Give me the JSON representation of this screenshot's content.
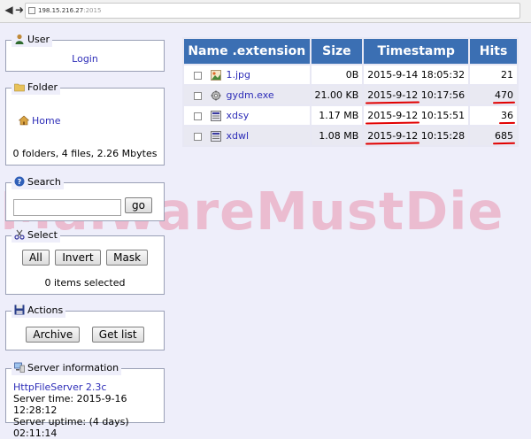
{
  "browser": {
    "url_host": "198.15.216.27",
    "url_port": ":2015"
  },
  "panels": {
    "user": {
      "title": "User",
      "login_label": "Login"
    },
    "folder": {
      "title": "Folder",
      "home_label": "Home",
      "summary": "0 folders, 4 files, 2.26 Mbytes"
    },
    "search": {
      "title": "Search",
      "input_value": "",
      "go_label": "go"
    },
    "select": {
      "title": "Select",
      "all_label": "All",
      "invert_label": "Invert",
      "mask_label": "Mask",
      "status": "0 items selected"
    },
    "actions": {
      "title": "Actions",
      "archive_label": "Archive",
      "getlist_label": "Get list"
    },
    "server": {
      "title": "Server information",
      "software": "HttpFileServer 2.3c",
      "time": "Server time: 2015-9-16 12:28:12",
      "uptime": "Server uptime: (4 days) 02:11:14"
    }
  },
  "table": {
    "headers": [
      "Name .extension",
      "Size",
      "Timestamp",
      "Hits"
    ],
    "rows": [
      {
        "name": "1.jpg",
        "size": "0B",
        "date": "2015-9-14",
        "time": "18:05:32",
        "hits": "21",
        "icon": "image-file-icon"
      },
      {
        "name": "gydm.exe",
        "size": "21.00 KB",
        "date": "2015-9-12",
        "time": "10:17:56",
        "hits": "470",
        "icon": "exe-file-icon"
      },
      {
        "name": "xdsy",
        "size": "1.17 MB",
        "date": "2015-9-12",
        "time": "10:15:51",
        "hits": "36",
        "icon": "binary-file-icon"
      },
      {
        "name": "xdwl",
        "size": "1.08 MB",
        "date": "2015-9-12",
        "time": "10:15:28",
        "hits": "685",
        "icon": "binary-file-icon"
      }
    ]
  },
  "watermark": "MalwareMustDie",
  "colors": {
    "header_blue": "#3b6fb3",
    "link_blue": "#2e2eb8",
    "underline_red": "#e10000",
    "page_bg": "#eeeefa"
  }
}
